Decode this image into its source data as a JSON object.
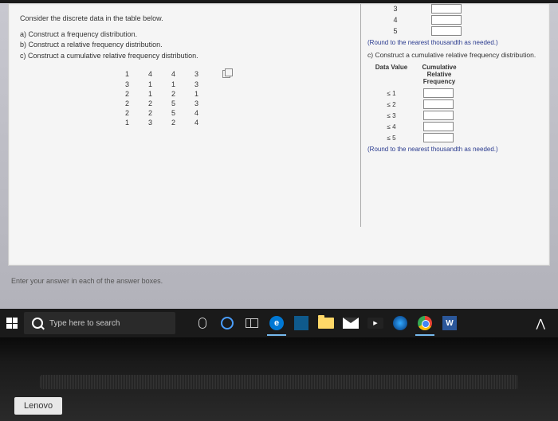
{
  "problem": {
    "intro": "Consider the discrete data in the table below.",
    "parts": {
      "a": "a) Construct a frequency distribution.",
      "b": "b) Construct a relative frequency distribution.",
      "c": "c) Construct a cumulative relative frequency distribution."
    },
    "data_rows": [
      [
        "1",
        "4",
        "4",
        "3"
      ],
      [
        "3",
        "1",
        "1",
        "3"
      ],
      [
        "2",
        "1",
        "2",
        "1"
      ],
      [
        "2",
        "2",
        "5",
        "3"
      ],
      [
        "2",
        "2",
        "5",
        "4"
      ],
      [
        "1",
        "3",
        "2",
        "4"
      ]
    ]
  },
  "right_panel": {
    "freq_values": [
      "3",
      "4",
      "5"
    ],
    "round_note": "(Round to the nearest thousandth as needed.)",
    "part_c_title": "c) Construct a cumulative relative frequency distribution.",
    "cum_header": {
      "col1": "Data Value",
      "col2": "Cumulative Relative Frequency"
    },
    "cum_rows": [
      "≤ 1",
      "≤ 2",
      "≤ 3",
      "≤ 4",
      "≤ 5"
    ]
  },
  "footer_note": "Enter your answer in each of the answer boxes.",
  "taskbar": {
    "search_placeholder": "Type here to search",
    "word_label": "W",
    "edge_label": "e",
    "yt_label": "▶"
  },
  "brand": "Lenovo"
}
